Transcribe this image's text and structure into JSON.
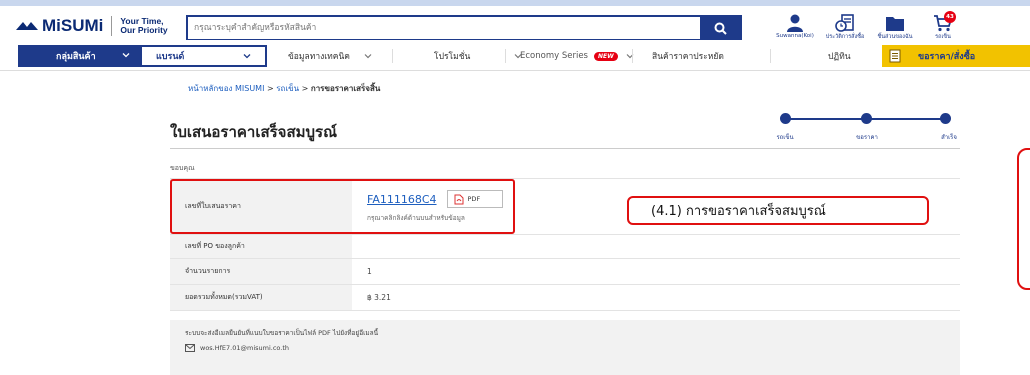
{
  "header": {
    "logo_text": "MiSUMi",
    "tagline_line1": "Your Time,",
    "tagline_line2": "Our Priority",
    "search_placeholder": "กรุณาระบุคำสำคัญหรือรหัสสินค้า",
    "icons": [
      {
        "name": "account-icon",
        "label": "Suwanna(Koi)"
      },
      {
        "name": "order-history-icon",
        "label": "ประวัติการสั่งซื้อ"
      },
      {
        "name": "my-components-icon",
        "label": "ชิ้นส่วนของฉัน"
      },
      {
        "name": "cart-icon",
        "label": "รถเข็น",
        "badge": "43"
      }
    ]
  },
  "nav": {
    "categories": "กลุ่มสินค้า",
    "brand": "แบรนด์",
    "technical": "ข้อมูลทางเทคนิค",
    "promotion": "โปรโมชั่น",
    "economy": "Economy Series",
    "new_badge": "NEW",
    "cost_saving": "สินค้าราคาประหยัด",
    "calendar": "ปฏิทิน",
    "quote_order": "ขอราคา/สั่งซื้อ"
  },
  "breadcrumb": {
    "home": "หน้าหลักของ MISUMI",
    "sep1": " > ",
    "cart": "รถเข็น",
    "sep2": " > ",
    "current": "การขอราคาเสร็จสิ้น"
  },
  "page_title": "ใบเสนอราคาเสร็จสมบูรณ์",
  "steps": [
    {
      "label": "รถเข็น"
    },
    {
      "label": "ขอราคา"
    },
    {
      "label": "สำเร็จ"
    }
  ],
  "thanks_text": "ขอบคุณ",
  "table": {
    "quote_no_label": "เลขที่ใบเสนอราคา",
    "quote_no_value": "FA111168C4",
    "pdf_label": "PDF",
    "quote_note": "กรุณาคลิกลิงค์ด้านบนสำหรับข้อมูล",
    "po_label": "เลขที่ PO ของลูกค้า",
    "po_value": "",
    "items_label": "จำนวนรายการ",
    "items_value": "1",
    "total_label": "ยอดรวมทั้งหมด(รวมVAT)",
    "total_value": "฿ 3.21"
  },
  "annotation": "(4.1) การขอราคาเสร็จสมบูรณ์",
  "footer": {
    "message": "ระบบจะส่งอีเมลยืนยันที่แนบใบขอราคาเป็นไฟล์ PDF ไปยังที่อยู่อีเมลนี้",
    "email": "wos.HfE7.01@misumi.co.th"
  },
  "colors": {
    "brand_navy": "#1e3a8a",
    "accent_yellow": "#f2c200",
    "annotation_red": "#e01010",
    "link_blue": "#1e5fbf"
  }
}
